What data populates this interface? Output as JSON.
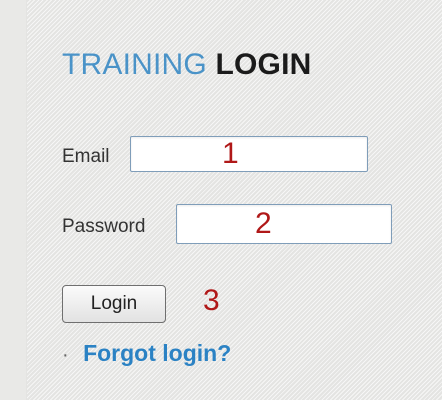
{
  "login": {
    "title_part1": "TRAINING",
    "title_part2": "LOGIN",
    "email_label": "Email",
    "email_annotation": "1",
    "password_label": "Password",
    "password_annotation": "2",
    "login_button_label": "Login",
    "login_annotation": "3",
    "bullet": "·",
    "forgot_login_text": "Forgot login?"
  },
  "colors": {
    "title_accent": "#4a93c8",
    "title_bold": "#1b1b1b",
    "annotation_red": "#b01818",
    "link_blue": "#2b82c4"
  }
}
